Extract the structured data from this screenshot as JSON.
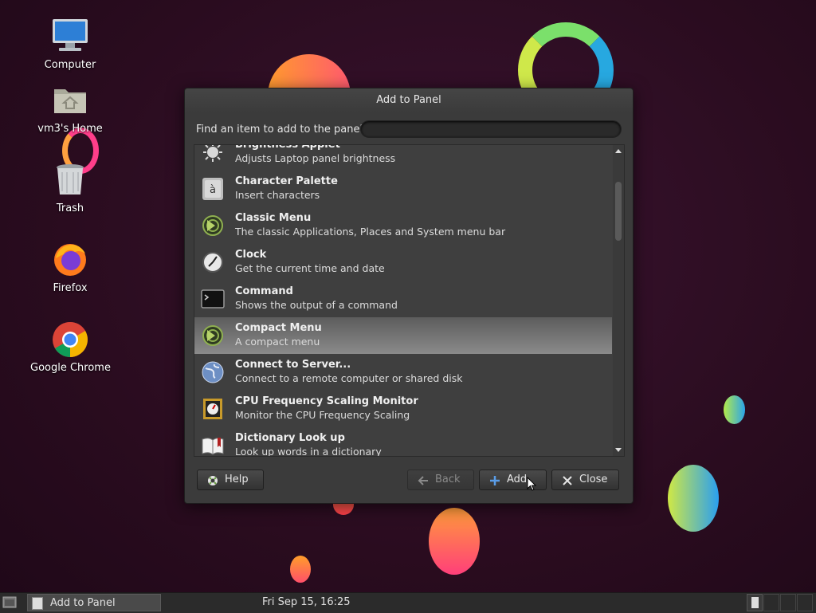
{
  "desktop": {
    "icons": [
      {
        "label": "Computer"
      },
      {
        "label": "vm3's Home"
      },
      {
        "label": "Trash"
      },
      {
        "label": "Firefox"
      },
      {
        "label": "Google Chrome"
      }
    ]
  },
  "dialog": {
    "title": "Add to Panel",
    "find_label": "Find an item to add to the panel:",
    "find_value": "",
    "items": [
      {
        "name": "Brightness Applet",
        "desc": "Adjusts Laptop panel brightness",
        "icon": "brightness-icon"
      },
      {
        "name": "Character Palette",
        "desc": "Insert characters",
        "icon": "character-palette-icon"
      },
      {
        "name": "Classic Menu",
        "desc": "The classic Applications, Places and System menu bar",
        "icon": "classic-menu-icon"
      },
      {
        "name": "Clock",
        "desc": "Get the current time and date",
        "icon": "clock-icon"
      },
      {
        "name": "Command",
        "desc": "Shows the output of a command",
        "icon": "terminal-icon"
      },
      {
        "name": "Compact Menu",
        "desc": "A compact menu",
        "icon": "compact-menu-icon",
        "selected": true
      },
      {
        "name": "Connect to Server...",
        "desc": "Connect to a remote computer or shared disk",
        "icon": "globe-icon"
      },
      {
        "name": "CPU Frequency Scaling Monitor",
        "desc": "Monitor the CPU Frequency Scaling",
        "icon": "cpu-icon"
      },
      {
        "name": "Dictionary Look up",
        "desc": "Look up words in a dictionary",
        "icon": "book-icon"
      }
    ],
    "buttons": {
      "help": "Help",
      "back": "Back",
      "add": "Add",
      "close": "Close"
    }
  },
  "taskbar": {
    "task_label": "Add to Panel",
    "clock": "Fri Sep 15, 16:25"
  },
  "colors": {
    "background": "#2a0c1f",
    "dialog": "#3b3b3b",
    "selection": "#8a8a8a"
  }
}
